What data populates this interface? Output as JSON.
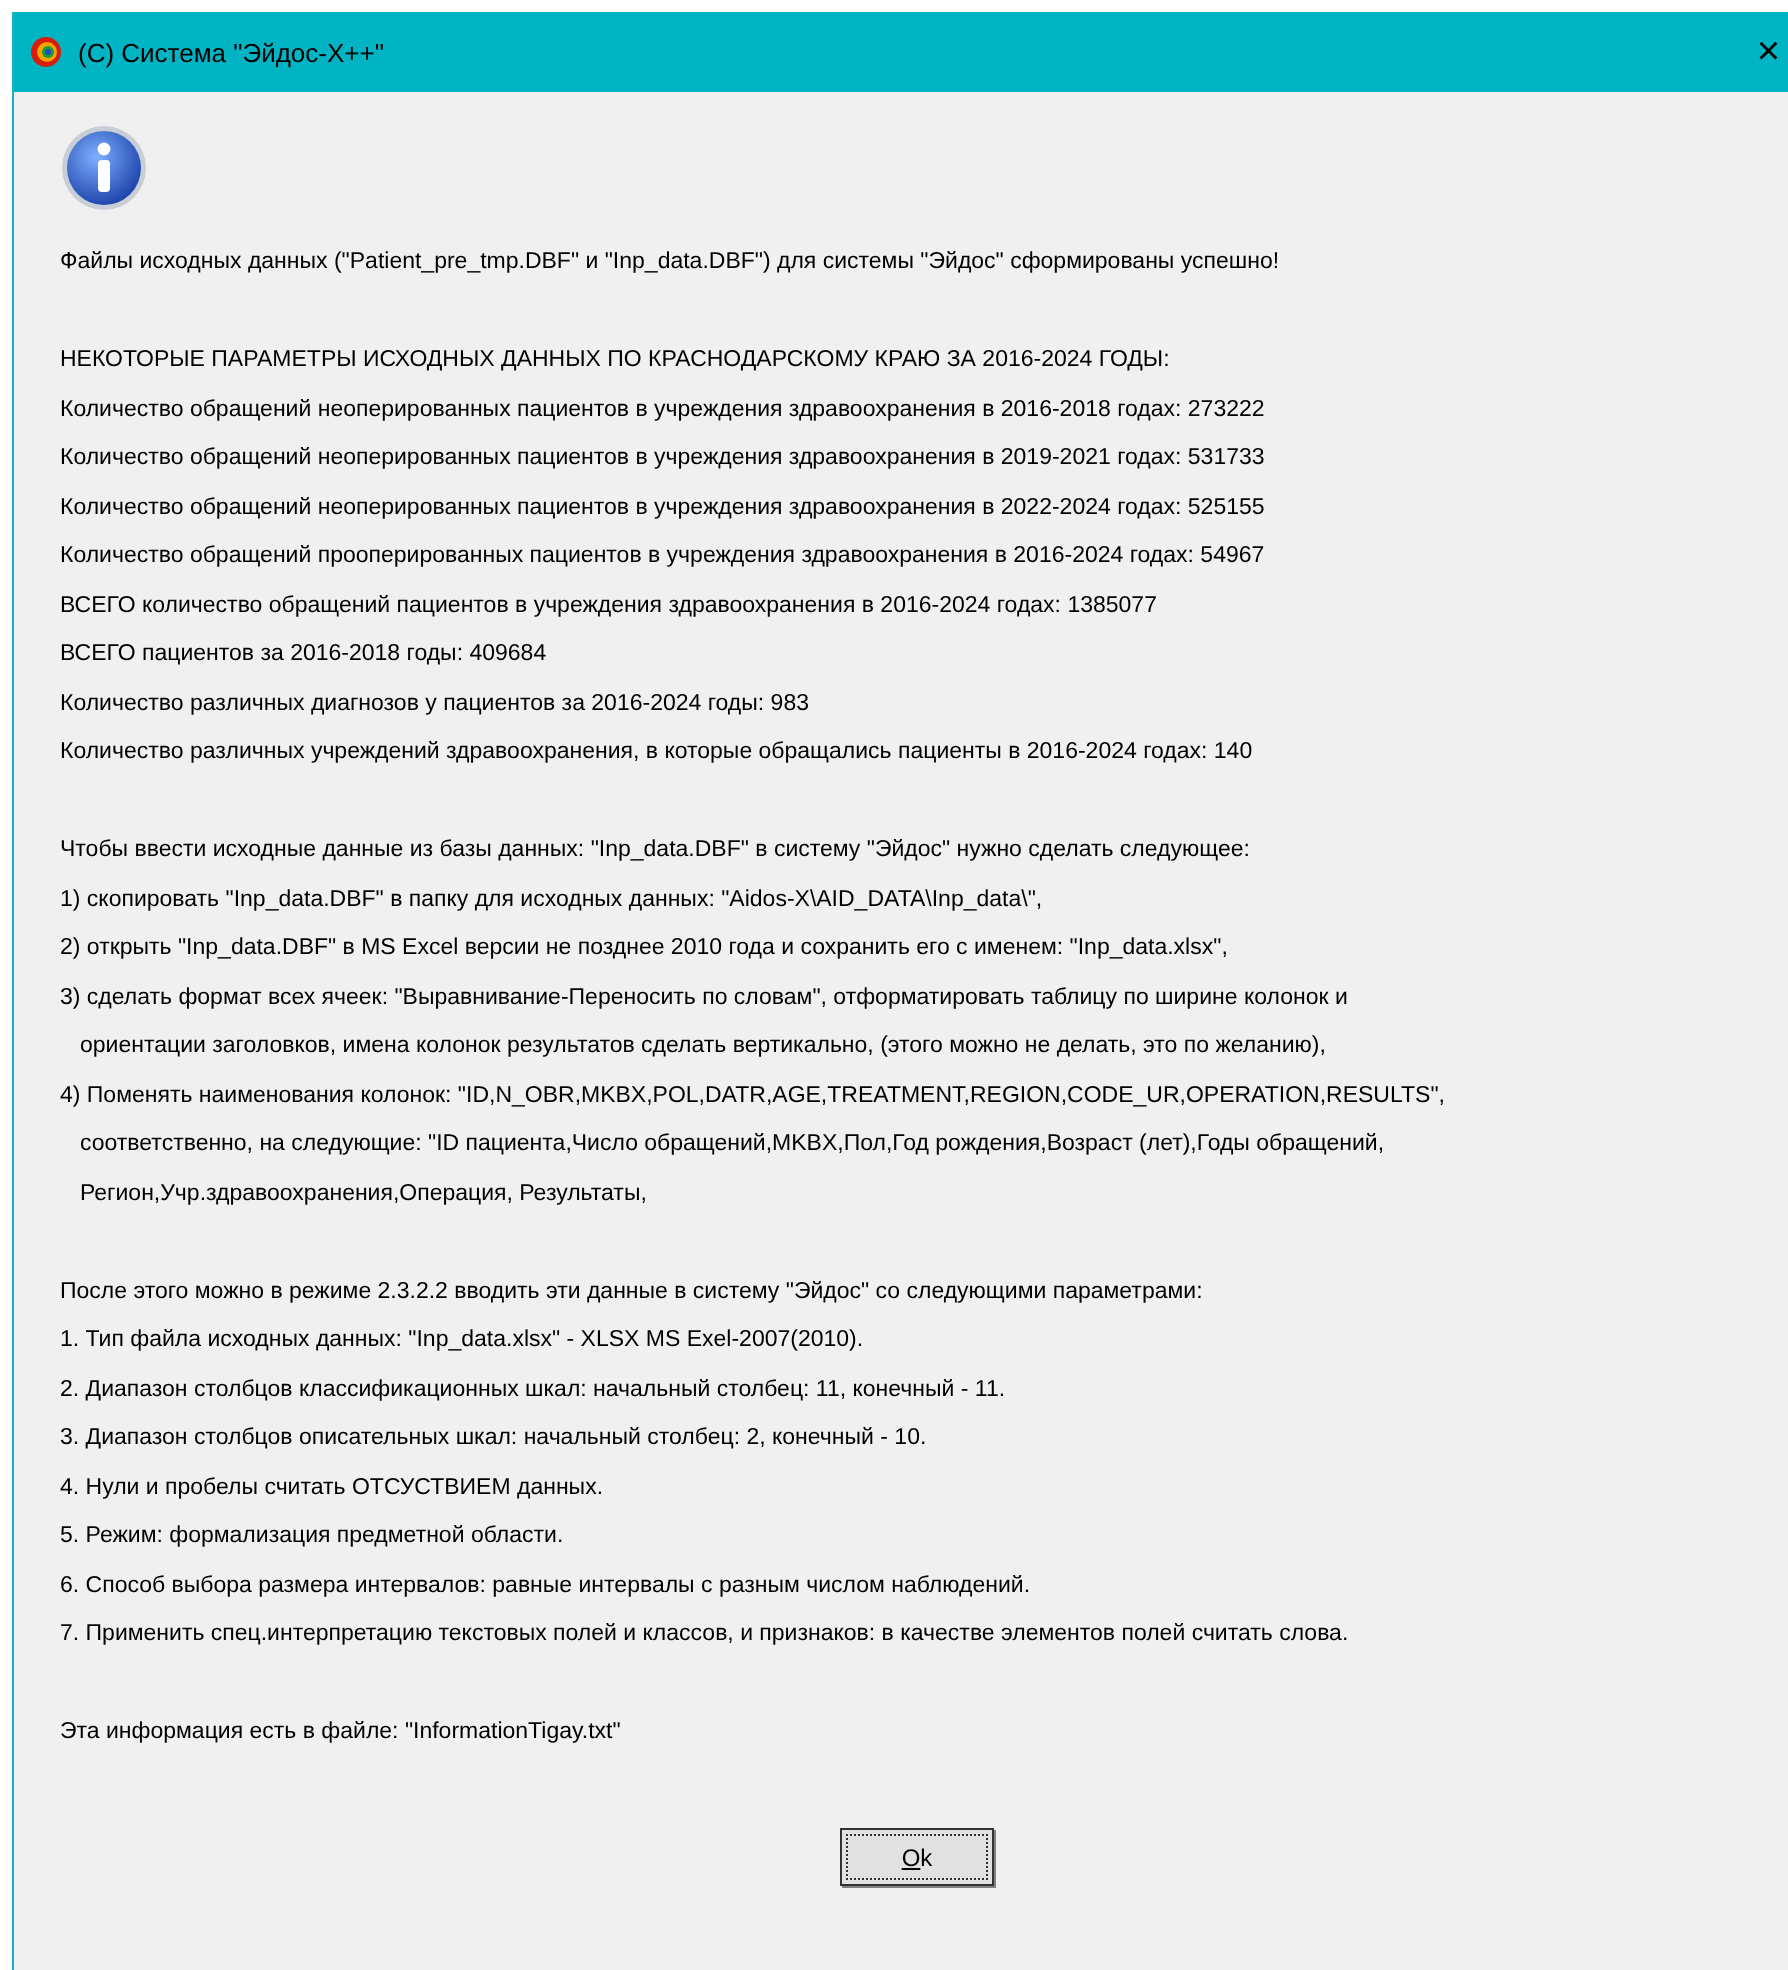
{
  "window": {
    "title": "(C) Система \"Эйдос-X++\"",
    "close": "×"
  },
  "message": {
    "paragraphs": [
      {
        "lines": [
          {
            "text": "Файлы исходных данных (\"Patient_pre_tmp.DBF\" и \"Inp_data.DBF\") для системы \"Эйдос\" сформированы успешно!",
            "continued": false
          }
        ]
      },
      {
        "lines": [
          {
            "text": "НЕКОТОРЫЕ ПАРАМЕТРЫ ИСХОДНЫХ ДАННЫХ ПО КРАСНОДАРСКОМУ КРАЮ ЗА 2016-2024 ГОДЫ:",
            "continued": false
          },
          {
            "text": "Количество обращений неоперированных пациентов в учреждения здравоохранения в 2016-2018 годах: 273222",
            "continued": false
          },
          {
            "text": "Количество обращений неоперированных пациентов в учреждения здравоохранения в 2019-2021 годах: 531733",
            "continued": false
          },
          {
            "text": "Количество обращений неоперированных пациентов в учреждения здравоохранения в 2022-2024 годах: 525155",
            "continued": false
          },
          {
            "text": "Количество обращений прооперированных пациентов в учреждения здравоохранения в 2016-2024 годах: 54967",
            "continued": false
          },
          {
            "text": "ВСЕГО количество обращений пациентов в учреждения здравоохранения в 2016-2024 годах: 1385077",
            "continued": false
          },
          {
            "text": "ВСЕГО пациентов за 2016-2018 годы: 409684",
            "continued": false
          },
          {
            "text": "Количество различных диагнозов у пациентов за 2016-2024 годы: 983",
            "continued": false
          },
          {
            "text": "Количество различных учреждений здравоохранения, в которые обращались пациенты в 2016-2024 годах: 140",
            "continued": false
          }
        ]
      },
      {
        "lines": [
          {
            "text": "Чтобы ввести исходные данные из базы данных: \"Inp_data.DBF\" в систему \"Эйдос\" нужно сделать следующее:",
            "continued": false
          },
          {
            "text": "1) скопировать \"Inp_data.DBF\" в папку для исходных данных: \"Aidos-X\\AID_DATA\\Inp_data\\\",",
            "continued": false
          },
          {
            "text": "2) открыть \"Inp_data.DBF\" в MS Excel версии не позднее 2010 года и сохранить его с именем: \"Inp_data.xlsx\",",
            "continued": false
          },
          {
            "text": "3) сделать формат всех ячеек: \"Выравнивание-Переносить по словам\", отформатировать таблицу по ширине колонок и",
            "continued": false
          },
          {
            "text": "ориентации заголовков, имена колонок результатов сделать вертикально, (этого можно не делать, это по желанию),",
            "continued": true
          },
          {
            "text": "4) Поменять наименования колонок: \"ID,N_OBR,MKBX,POL,DATR,AGE,TREATMENT,REGION,CODE_UR,OPERATION,RESULTS\",",
            "continued": false
          },
          {
            "text": "соответственно, на следующие: \"ID пациента,Число обращений,MKBX,Пол,Год рождения,Возраст (лет),Годы обращений,",
            "continued": true
          },
          {
            "text": "Регион,Учр.здравоохранения,Операция, Результаты,",
            "continued": true
          }
        ]
      },
      {
        "lines": [
          {
            "text": "После этого можно в режиме 2.3.2.2 вводить эти данные в систему \"Эйдос\" со следующими параметрами:",
            "continued": false
          },
          {
            "text": "1. Тип файла исходных данных: \"Inp_data.xlsx\" - XLSX MS Exel-2007(2010).",
            "continued": false
          },
          {
            "text": "2. Диапазон столбцов классификационных шкал: начальный столбец: 11, конечный - 11.",
            "continued": false
          },
          {
            "text": "3. Диапазон столбцов описательных шкал: начальный столбец: 2, конечный - 10.",
            "continued": false
          },
          {
            "text": "4. Нули и пробелы считать ОТСУСТВИЕМ данных.",
            "continued": false
          },
          {
            "text": "5. Режим: формализация предметной области.",
            "continued": false
          },
          {
            "text": "6. Способ выбора размера интервалов: равные интервалы с разным числом наблюдений.",
            "continued": false
          },
          {
            "text": "7. Применить спец.интерпретацию текстовых полей и классов, и признаков: в качестве элементов полей считать слова.",
            "continued": false
          }
        ]
      },
      {
        "lines": [
          {
            "text": "Эта информация есть в файле: \"InformationTigay.txt\"",
            "continued": false
          }
        ]
      }
    ]
  },
  "buttons": [
    {
      "label": "Ok",
      "focused": true
    }
  ]
}
